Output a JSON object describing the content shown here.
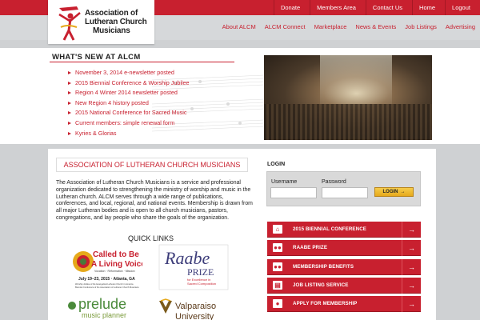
{
  "logo": {
    "line1": "Association of",
    "line2": "Lutheran Church",
    "line3": "Musicians"
  },
  "top_links": [
    "Donate",
    "Members Area",
    "Contact Us",
    "Home",
    "Logout"
  ],
  "main_nav": [
    "About ALCM",
    "ALCM Connect",
    "Marketplace",
    "News & Events",
    "Job Listings",
    "Advertising"
  ],
  "whats_new": {
    "title": "WHAT'S NEW AT ALCM",
    "items": [
      "November 3, 2014 e-newsletter posted",
      "2015 Biennial Conference & Worship Jubilee",
      "Region 4 Winter 2014 newsletter posted",
      "New Region 4 history posted",
      "2015 National Conference for Sacred Music",
      "Current members: simple renewal form",
      "Kyries & Glorias"
    ]
  },
  "about": {
    "title": "ASSOCIATION OF LUTHERAN CHURCH MUSICIANS",
    "text": "The Association of Lutheran Church Musicians is a service and professional organization dedicated to strengthening the ministry of worship and music in the Lutheran church. ALCM serves through a wide range of publications, conferences, and local, regional, and national events. Membership is drawn from all major Lutheran bodies and is open to all church musicians, pastors, congregations, and lay people who share the goals of the organization."
  },
  "quick_links": {
    "title": "QUICK LINKS",
    "called": {
      "line1": "Called to Be",
      "line2": "A Living Voice",
      "sub": "Vocation · Reformation · Mission",
      "dates": "July 19–23, 2015 · Atlanta, GA",
      "desc1": "Worship Jubilee of the Evangelical Lutheran Church in America",
      "desc2": "Biennial Conference of the Association of Lutheran Church Musicians"
    },
    "raabe": {
      "word": "Raabe",
      "prize": "PRIZE",
      "sub1": "for Excellence in",
      "sub2": "Sacred Composition"
    },
    "prelude": {
      "word": "prelude",
      "sub": "music planner"
    },
    "valpo": {
      "line1": "Valparaiso",
      "line2": "University"
    }
  },
  "login": {
    "title": "LOGIN",
    "username_label": "Username",
    "password_label": "Password",
    "button": "LOGIN"
  },
  "actions": [
    {
      "label": "2015 BIENNIAL CONFERENCE",
      "icon": "house-icon"
    },
    {
      "label": "RAABE PRIZE",
      "icon": "people-icon"
    },
    {
      "label": "MEMBERSHIP BENEFITS",
      "icon": "people-icon"
    },
    {
      "label": "JOB LISTING SERVICE",
      "icon": "id-card-icon"
    },
    {
      "label": "APPLY FOR MEMBERSHIP",
      "icon": "person-icon"
    }
  ],
  "colors": {
    "brand_red": "#c8202f",
    "nav_gray": "#d6d8da",
    "button_gold": "#e6a91b"
  }
}
